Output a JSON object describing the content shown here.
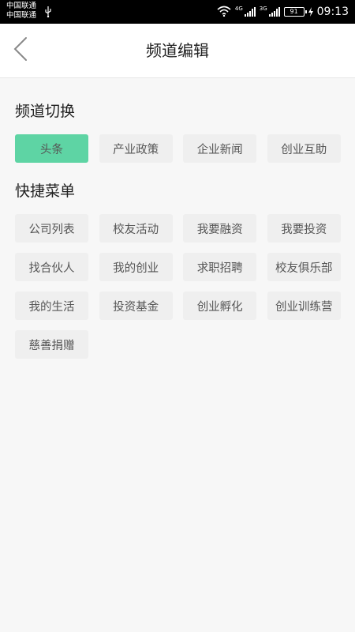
{
  "status_bar": {
    "carrier_1": "中国联通",
    "carrier_2": "中国联通",
    "network_1": "4G",
    "network_2": "3G",
    "battery": "91",
    "time": "09:13"
  },
  "header": {
    "title": "频道编辑"
  },
  "channel_switch": {
    "title": "频道切换",
    "items": [
      {
        "label": "头条",
        "active": true
      },
      {
        "label": "产业政策",
        "active": false
      },
      {
        "label": "企业新闻",
        "active": false
      },
      {
        "label": "创业互助",
        "active": false
      }
    ]
  },
  "shortcut_menu": {
    "title": "快捷菜单",
    "items": [
      {
        "label": "公司列表"
      },
      {
        "label": "校友活动"
      },
      {
        "label": "我要融资"
      },
      {
        "label": "我要投资"
      },
      {
        "label": "找合伙人"
      },
      {
        "label": "我的创业"
      },
      {
        "label": "求职招聘"
      },
      {
        "label": "校友俱乐部"
      },
      {
        "label": "我的生活"
      },
      {
        "label": "投资基金"
      },
      {
        "label": "创业孵化"
      },
      {
        "label": "创业训练营"
      },
      {
        "label": "慈善捐赠"
      }
    ]
  },
  "colors": {
    "accent": "#5ed4a4",
    "tag_bg": "#efefef",
    "page_bg": "#f7f7f7"
  }
}
